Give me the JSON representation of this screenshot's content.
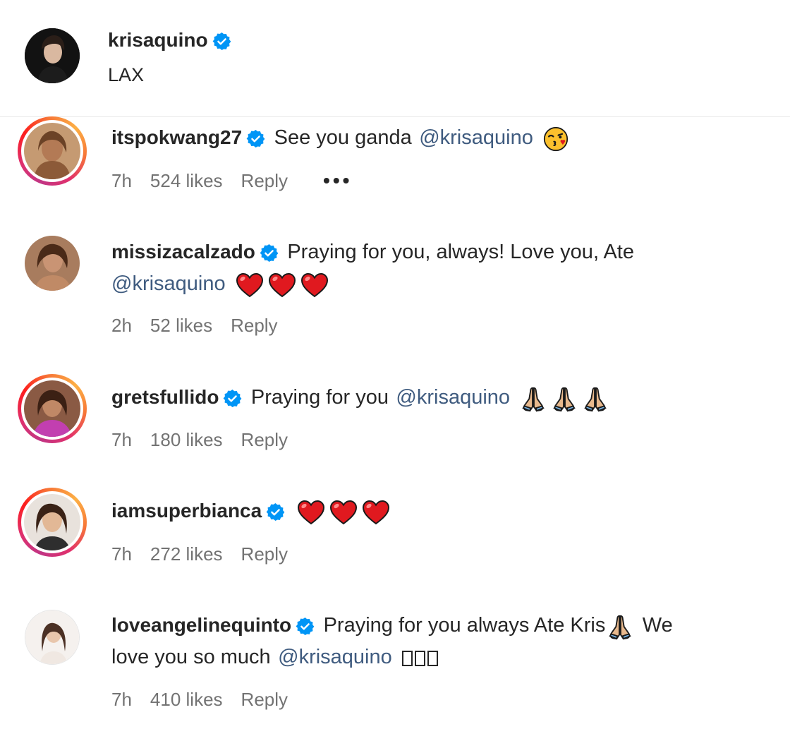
{
  "post": {
    "username": "krisaquino",
    "caption": "LAX"
  },
  "comments": [
    {
      "username": "itspokwang27",
      "text": "See you ganda",
      "mention": "@krisaquino",
      "emoji": "kissing-face-icon",
      "time": "7h",
      "likes": "524 likes",
      "reply": "Reply",
      "more": "•••"
    },
    {
      "username": "missizacalzado",
      "text": "Praying for you, always! Love you, Ate",
      "mention": "@krisaquino",
      "emoji": "red-heart-icon x3",
      "time": "2h",
      "likes": "52 likes",
      "reply": "Reply"
    },
    {
      "username": "gretsfullido",
      "text": "Praying for you",
      "mention": "@krisaquino",
      "emoji": "praying-hands-icon x3",
      "time": "7h",
      "likes": "180 likes",
      "reply": "Reply"
    },
    {
      "username": "iamsuperbianca",
      "text": "",
      "emoji": "red-heart-icon x3",
      "time": "7h",
      "likes": "272 likes",
      "reply": "Reply"
    },
    {
      "username": "loveangelinequinto",
      "text": "Praying for you always Ate Kris",
      "text2": "We",
      "text3": "love you so much",
      "mention": "@krisaquino",
      "emoji": "praying-hands-icon",
      "time": "7h",
      "likes": "410 likes",
      "reply": "Reply"
    }
  ],
  "colors": {
    "mention": "#3f5b7f",
    "meta": "#737373",
    "verified": "#0095f6"
  }
}
